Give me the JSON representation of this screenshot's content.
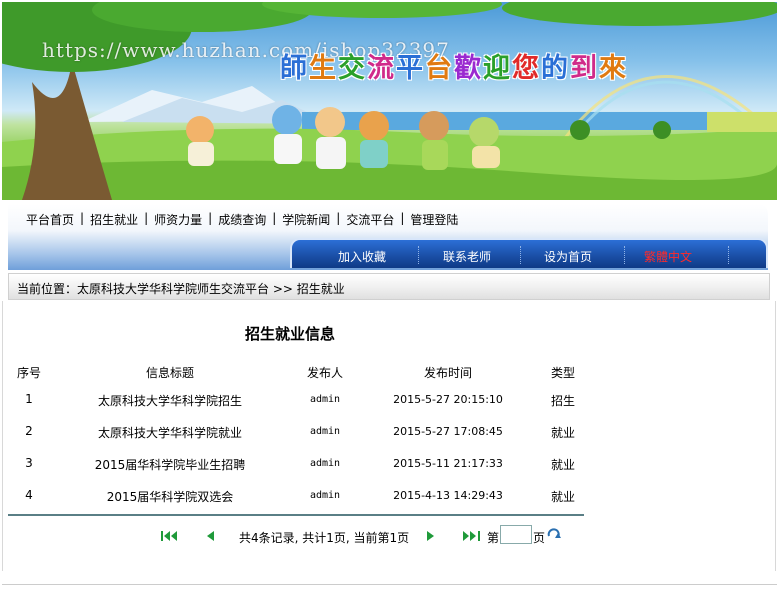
{
  "banner": {
    "watermark": "https://www.huzhan.com/ishop32397",
    "slogan": [
      "師",
      "生",
      "交",
      "流",
      "平",
      "台",
      "歡",
      "迎",
      "您",
      "的",
      "到",
      "來"
    ],
    "slogan_colors": [
      "#2a6fd6",
      "#e07a10",
      "#2aa02a",
      "#d02a8a",
      "#2a6fd6",
      "#e07a10",
      "#9a2ad0",
      "#2aa02a",
      "#e02a2a",
      "#2a6fd6",
      "#d02a8a",
      "#e07a10"
    ]
  },
  "topnav": {
    "items": [
      "平台首页",
      "招生就业",
      "师资力量",
      "成绩查询",
      "学院新闻",
      "交流平台",
      "管理登陆"
    ],
    "separator": "|"
  },
  "subnav": {
    "items": [
      "加入收藏",
      "联系老师",
      "设为首页",
      "繁體中文"
    ]
  },
  "location": {
    "label": "当前位置：",
    "site": "太原科技大学华科学院师生交流平台",
    "arrow": ">>",
    "page": "招生就业"
  },
  "content": {
    "title": "招生就业信息",
    "headers": [
      "序号",
      "信息标题",
      "发布人",
      "发布时间",
      "类型"
    ],
    "rows": [
      {
        "no": "1",
        "title": "太原科技大学华科学院招生",
        "author": "admin",
        "time": "2015-5-27 20:15:10",
        "type": "招生"
      },
      {
        "no": "2",
        "title": "太原科技大学华科学院就业",
        "author": "admin",
        "time": "2015-5-27 17:08:45",
        "type": "就业"
      },
      {
        "no": "3",
        "title": "2015届华科学院毕业生招聘",
        "author": "admin",
        "time": "2015-5-11 21:17:33",
        "type": "就业"
      },
      {
        "no": "4",
        "title": "2015届华科学院双选会",
        "author": "admin",
        "time": "2015-4-13 14:29:43",
        "type": "就业"
      }
    ]
  },
  "pager": {
    "summary": "共4条记录, 共计1页, 当前第1页",
    "goto_prefix": "第",
    "goto_suffix": "页",
    "input_value": "",
    "icons": [
      "first-page-icon",
      "prev-page-icon",
      "next-page-icon",
      "last-page-icon",
      "go-icon"
    ],
    "icon_color": "#1f9a3a"
  }
}
